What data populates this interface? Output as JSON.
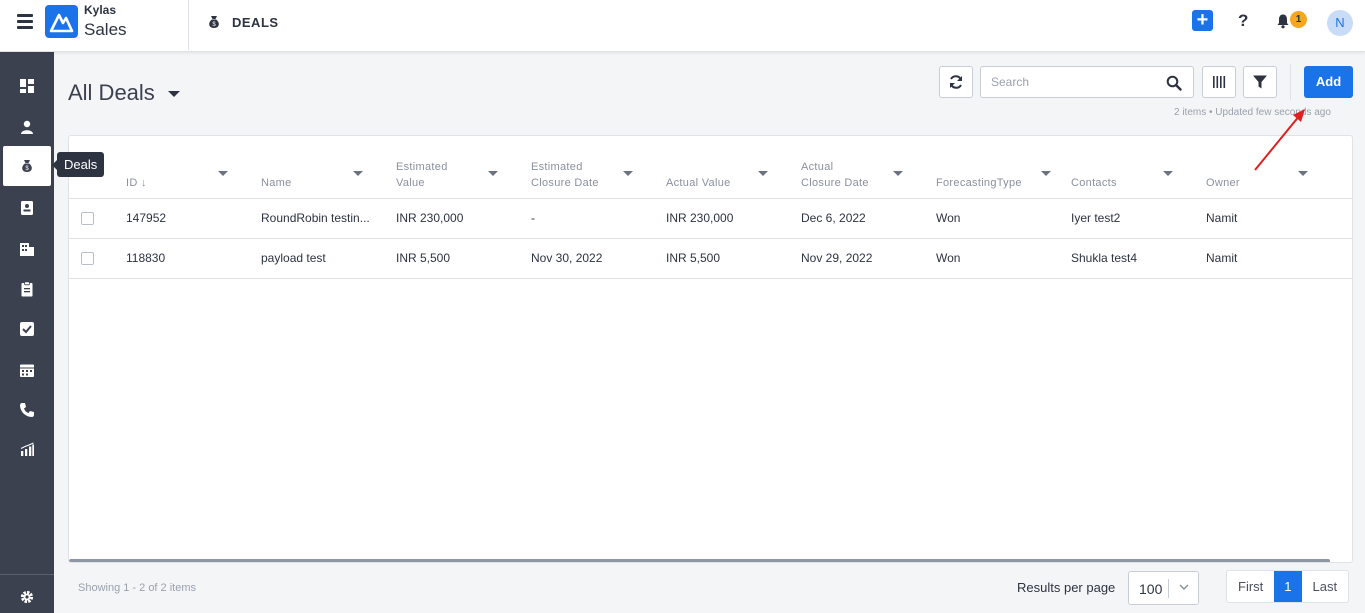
{
  "app": {
    "brand_top": "Kylas",
    "brand_bottom": "Sales",
    "module_title": "DEALS",
    "notification_count": "1",
    "avatar_initial": "N"
  },
  "sidebar": {
    "items": [
      {
        "icon": "dashboard-icon"
      },
      {
        "icon": "user-icon"
      },
      {
        "icon": "money-bag-icon",
        "active": true
      },
      {
        "icon": "contact-card-icon"
      },
      {
        "icon": "building-icon"
      },
      {
        "icon": "clipboard-icon"
      },
      {
        "icon": "checkbox-icon"
      },
      {
        "icon": "calendar-icon"
      },
      {
        "icon": "phone-icon"
      },
      {
        "icon": "report-icon"
      },
      {
        "icon": "gear-icon"
      }
    ],
    "tooltip": "Deals"
  },
  "header": {
    "title": "All Deals",
    "search_placeholder": "Search",
    "add_label": "Add",
    "status": "2 items • Updated few seconds ago"
  },
  "table": {
    "columns": [
      {
        "label": "ID ↓",
        "lines": [
          "ID ↓"
        ]
      },
      {
        "label": "Name",
        "lines": [
          "Name"
        ]
      },
      {
        "label": "Estimated Value",
        "lines": [
          "Estimated",
          "Value"
        ]
      },
      {
        "label": "Estimated Closure Date",
        "lines": [
          "Estimated",
          "Closure Date"
        ]
      },
      {
        "label": "Actual Value",
        "lines": [
          "Actual Value"
        ]
      },
      {
        "label": "Actual Closure Date",
        "lines": [
          "Actual",
          "Closure Date"
        ]
      },
      {
        "label": "ForecastingType",
        "lines": [
          "ForecastingType"
        ]
      },
      {
        "label": "Contacts",
        "lines": [
          "Contacts"
        ]
      },
      {
        "label": "Owner",
        "lines": [
          "Owner"
        ]
      }
    ],
    "rows": [
      [
        "147952",
        "RoundRobin testin...",
        "INR 230,000",
        "-",
        "INR 230,000",
        "Dec 6, 2022",
        "Won",
        "Iyer test2",
        "Namit"
      ],
      [
        "118830",
        "payload test",
        "INR 5,500",
        "Nov 30, 2022",
        "INR 5,500",
        "Nov 29, 2022",
        "Won",
        "Shukla test4",
        "Namit"
      ]
    ]
  },
  "footer": {
    "showing": "Showing 1 - 2 of 2 items",
    "rpp_label": "Results per page",
    "rpp_value": "100",
    "pager": {
      "first": "First",
      "current": "1",
      "last": "Last"
    }
  },
  "colors": {
    "accent": "#1a73e8",
    "sidebar": "#3c4150",
    "badge": "#f5a623",
    "annotation_arrow": "#e02020"
  }
}
